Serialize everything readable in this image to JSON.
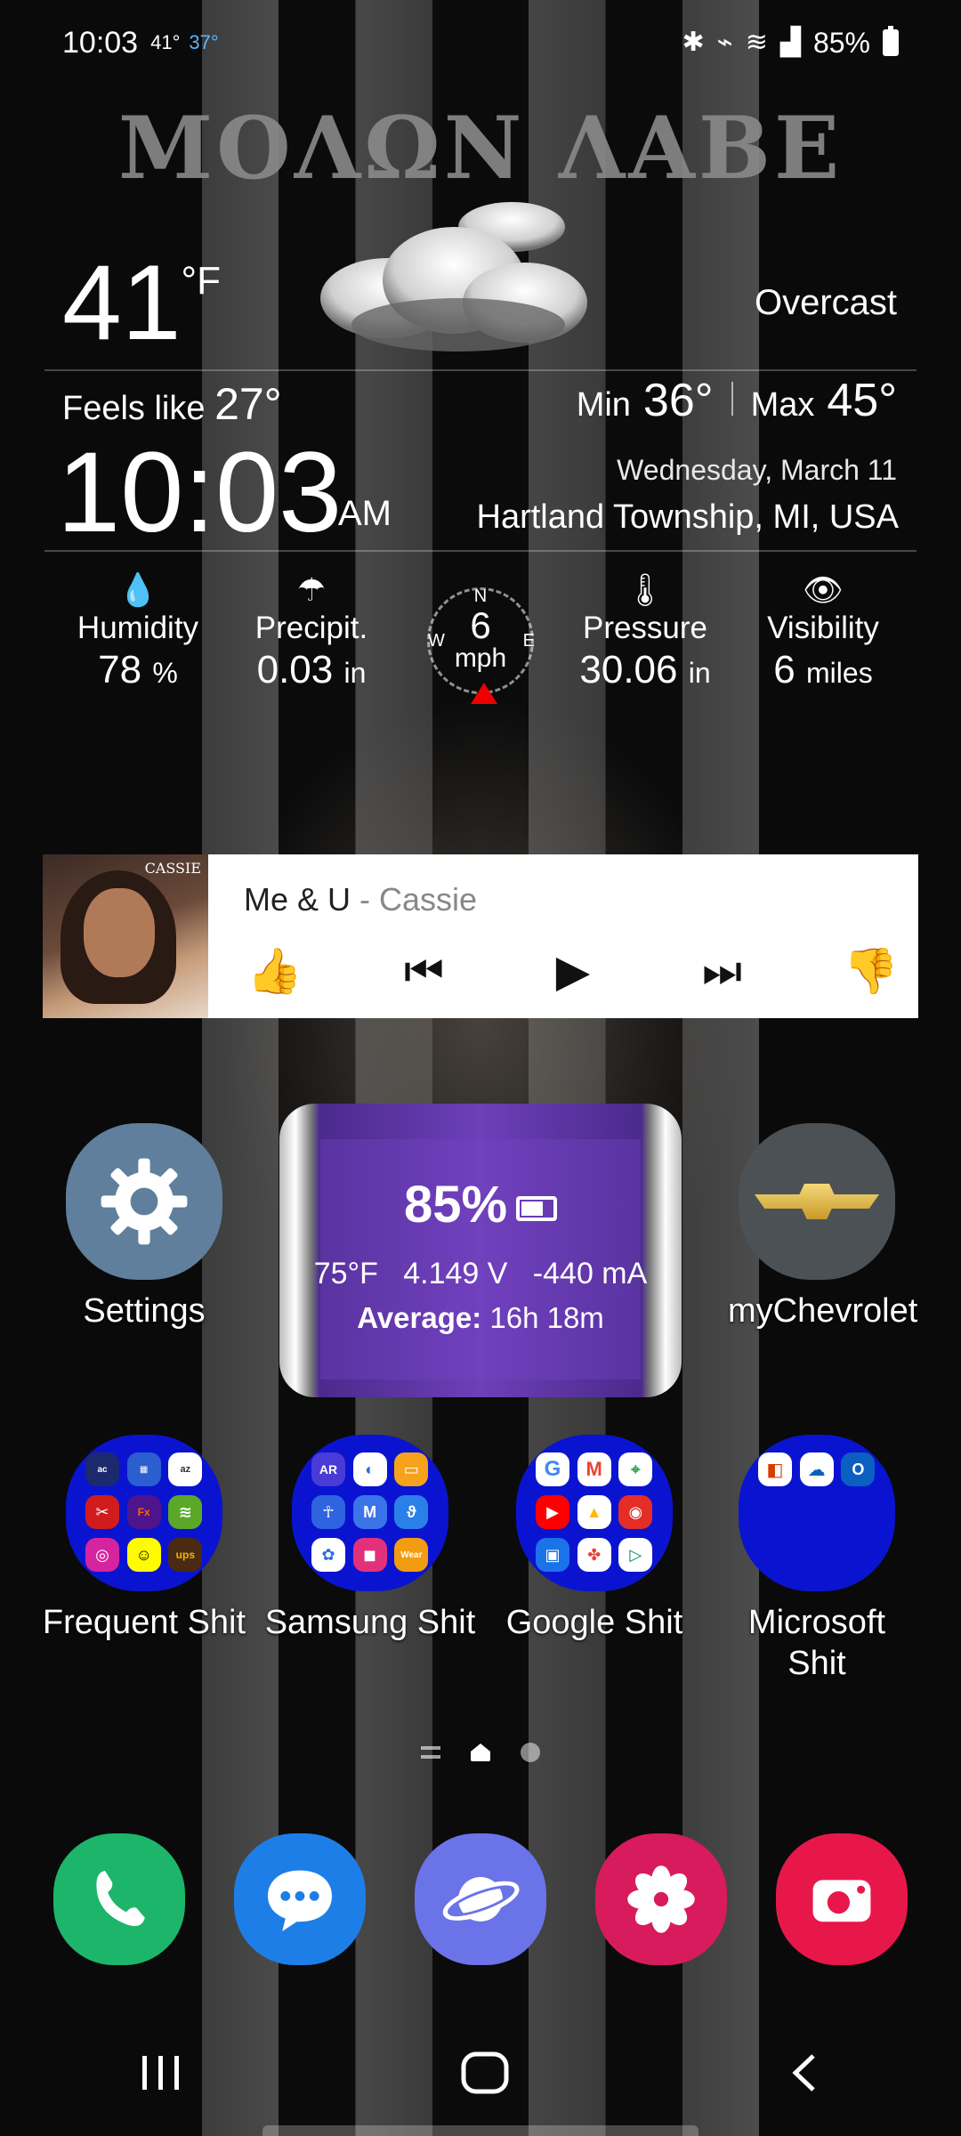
{
  "status": {
    "time": "10:03",
    "temp_current": "41°",
    "temp_low": "37°",
    "battery": "85%"
  },
  "wallpaper": {
    "title": "ΜΟΛΩΝ ΛΑΒΕ"
  },
  "weather": {
    "temperature": "41",
    "unit": "°F",
    "condition": "Overcast",
    "feels_label": "Feels like",
    "feels_value": "27°",
    "min_label": "Min",
    "min_value": "36°",
    "max_label": "Max",
    "max_value": "45°",
    "clock": "10:03",
    "ampm": "AM",
    "date": "Wednesday, March 11",
    "location": "Hartland Township, MI, USA",
    "stats": {
      "humidity": {
        "label": "Humidity",
        "value": "78",
        "unit": "%"
      },
      "precip": {
        "label": "Precipit.",
        "value": "0.03",
        "unit": "in"
      },
      "wind": {
        "value": "6",
        "unit": "mph",
        "n": "N",
        "e": "E",
        "w": "W"
      },
      "pressure": {
        "label": "Pressure",
        "value": "30.06",
        "unit": "in"
      },
      "visibility": {
        "label": "Visibility",
        "value": "6",
        "unit": "miles"
      }
    }
  },
  "music": {
    "title": "Me & U",
    "separator": " - ",
    "artist": "Cassie",
    "album_text": "CASSIE"
  },
  "apps": {
    "settings": "Settings",
    "chevrolet": "myChevrolet"
  },
  "battery_widget": {
    "percent": "85%",
    "temp": "75°F",
    "voltage": "4.149 V",
    "current": "-440 mA",
    "avg_label": "Average:",
    "avg_value": "16h 18m"
  },
  "folders": {
    "frequent": "Frequent Shit",
    "samsung": "Samsung Shit",
    "google": "Google Shit",
    "microsoft_1": "Microsoft",
    "microsoft_2": "Shit"
  },
  "colors": {
    "settings": "#5f7f9c",
    "folder": "#0a14d0",
    "phone": "#1db56a",
    "messages": "#1e7ee8",
    "internet": "#6a73e8",
    "gallery": "#d81b5c",
    "camera": "#e8174a"
  }
}
